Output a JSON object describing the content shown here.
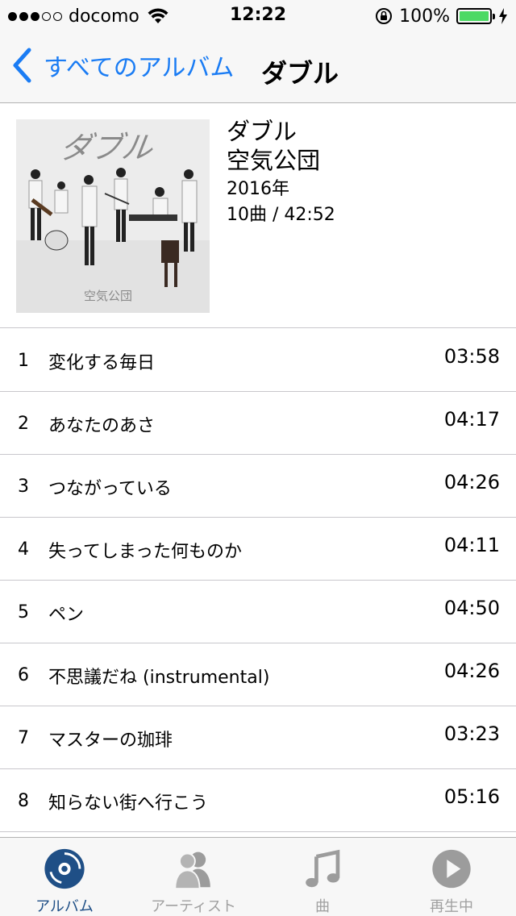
{
  "status": {
    "carrier": "docomo",
    "time": "12:22",
    "battery": "100%"
  },
  "nav": {
    "back_label": "すべてのアルバム",
    "title": "ダブル"
  },
  "album": {
    "title": "ダブル",
    "artist": "空気公団",
    "year": "2016年",
    "meta": "10曲 / 42:52",
    "cover_title": "ダブル",
    "cover_artist": "空気公団"
  },
  "tracks": [
    {
      "num": "1",
      "title": "変化する毎日",
      "duration": "03:58"
    },
    {
      "num": "2",
      "title": "あなたのあさ",
      "duration": "04:17"
    },
    {
      "num": "3",
      "title": "つながっている",
      "duration": "04:26"
    },
    {
      "num": "4",
      "title": "失ってしまった何ものか",
      "duration": "04:11"
    },
    {
      "num": "5",
      "title": "ペン",
      "duration": "04:50"
    },
    {
      "num": "6",
      "title": "不思議だね (instrumental)",
      "duration": "04:26"
    },
    {
      "num": "7",
      "title": "マスターの珈琲",
      "duration": "03:23"
    },
    {
      "num": "8",
      "title": "知らない街へ行こう",
      "duration": "05:16"
    }
  ],
  "tabs": [
    {
      "label": "アルバム",
      "icon": "album-icon",
      "active": true
    },
    {
      "label": "アーティスト",
      "icon": "artists-icon",
      "active": false
    },
    {
      "label": "曲",
      "icon": "music-note-icon",
      "active": false
    },
    {
      "label": "再生中",
      "icon": "play-icon",
      "active": false
    }
  ],
  "colors": {
    "accent": "#1a7cf4",
    "tab_active": "#1f4f86",
    "tab_inactive": "#a0a0a0",
    "battery": "#4cd964"
  }
}
